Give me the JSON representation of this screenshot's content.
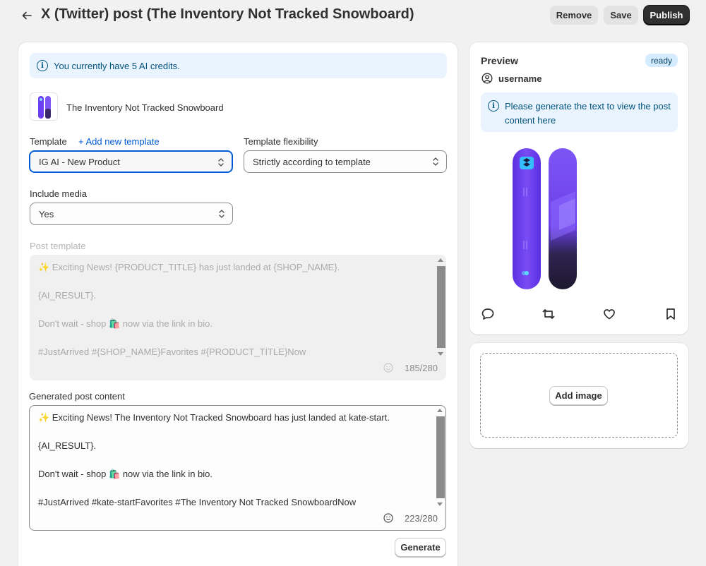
{
  "header": {
    "back_icon": "arrow-left-icon",
    "title": "X (Twitter) post (The Inventory Not Tracked Snowboard)",
    "remove_label": "Remove",
    "save_label": "Save",
    "publish_label": "Publish"
  },
  "banner": {
    "text": "You currently have 5 AI credits."
  },
  "product": {
    "name": "The Inventory Not Tracked Snowboard"
  },
  "form": {
    "template_label": "Template",
    "add_template_link": "+ Add new template",
    "template_value": "IG AI - New Product",
    "flexibility_label": "Template flexibility",
    "flexibility_value": "Strictly according to template",
    "media_label": "Include media",
    "media_value": "Yes",
    "post_template_label": "Post template",
    "post_template_lines": [
      "✨ Exciting News! {PRODUCT_TITLE} has just landed at {SHOP_NAME}.",
      "{AI_RESULT}.",
      "Don't wait - shop 🛍️ now via the link in bio.",
      "#JustArrived #{SHOP_NAME}Favorites #{PRODUCT_TITLE}Now"
    ],
    "post_template_counter": "185/280",
    "generated_label": "Generated post content",
    "generated_lines": [
      "✨ Exciting News! The Inventory Not Tracked Snowboard has just landed at kate-start.",
      "{AI_RESULT}.",
      "Don't wait - shop 🛍️ now via the link in bio.",
      "#JustArrived #kate-startFavorites #The Inventory Not Tracked SnowboardNow"
    ],
    "generated_counter": "223/280",
    "generate_label": "Generate"
  },
  "preview": {
    "title": "Preview",
    "status_badge": "ready",
    "username": "username",
    "info_text": "Please generate the text to view the post content here",
    "actions": [
      "reply-icon",
      "retweet-icon",
      "like-icon",
      "bookmark-icon"
    ]
  },
  "media": {
    "add_image_label": "Add image"
  },
  "colors": {
    "accent": "#005bd3",
    "info_bg": "#eaf4ff",
    "info_text": "#00527c",
    "publish_bg": "#303030",
    "snowboard_purple": "#6b3df0"
  }
}
